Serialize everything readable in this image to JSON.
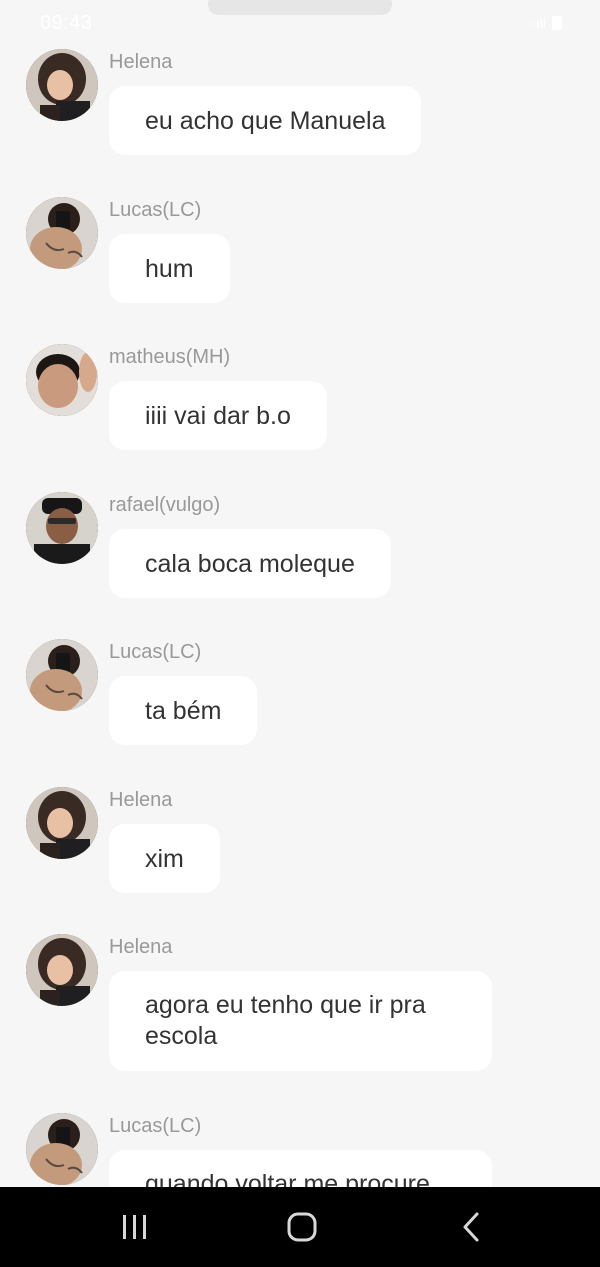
{
  "status_bar": {
    "time": "09:43",
    "signal_icons": "◌ıll"
  },
  "messages": [
    {
      "sender": "Helena",
      "text": "eu acho que Manuela",
      "avatar": "helena-avatar"
    },
    {
      "sender": "Lucas(LC)",
      "text": "hum",
      "avatar": "lucas-avatar"
    },
    {
      "sender": "matheus(MH)",
      "text": "iiii vai dar b.o",
      "avatar": "matheus-avatar"
    },
    {
      "sender": "rafael(vulgo)",
      "text": "cala boca moleque",
      "avatar": "rafael-avatar"
    },
    {
      "sender": "Lucas(LC)",
      "text": "ta bém",
      "avatar": "lucas-avatar"
    },
    {
      "sender": "Helena",
      "text": "xim",
      "avatar": "helena-avatar"
    },
    {
      "sender": "Helena",
      "text": "agora eu tenho que ir pra escola",
      "avatar": "helena-avatar"
    },
    {
      "sender": "Lucas(LC)",
      "text": "quando voltar me procure",
      "avatar": "lucas-avatar"
    }
  ],
  "nav_bar": {
    "buttons": [
      "recents-icon",
      "home-icon",
      "back-icon"
    ]
  },
  "colors": {
    "background": "#f6f6f6",
    "bubble": "#ffffff",
    "sender_text": "#999999",
    "message_text": "#333333",
    "nav_bar": "#000000"
  }
}
